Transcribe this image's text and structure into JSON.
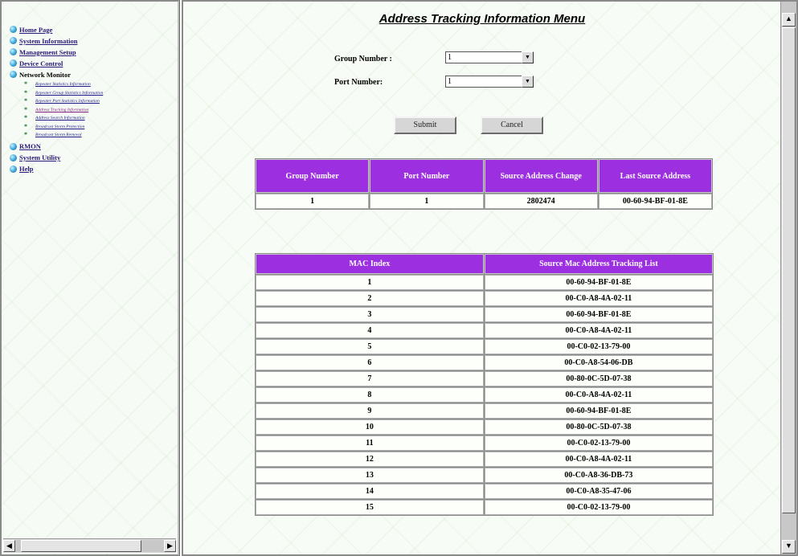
{
  "nav": {
    "items": [
      {
        "label": "Home Page"
      },
      {
        "label": "System Information"
      },
      {
        "label": "Management Setup"
      },
      {
        "label": "Device Control"
      },
      {
        "label": "Network Monitor"
      },
      {
        "label": "RMON"
      },
      {
        "label": "System Utility"
      },
      {
        "label": "Help"
      }
    ],
    "sub_items": [
      {
        "label": "Repeater Statistics Information"
      },
      {
        "label": "Repeater Group Statistics Information"
      },
      {
        "label": "Repeater Port Statistics Information"
      },
      {
        "label": "Address Tracking Information"
      },
      {
        "label": "Address Search Information"
      },
      {
        "label": "Broadcast Storm Protection"
      },
      {
        "label": "Broadcast Storm Removal"
      }
    ]
  },
  "page": {
    "title": "Address Tracking Information Menu"
  },
  "form": {
    "group_label": "Group Number :",
    "group_value": "1",
    "port_label": "Port Number:",
    "port_value": "1",
    "submit_label": "Submit",
    "cancel_label": "Cancel"
  },
  "summary": {
    "headers": [
      "Group Number",
      "Port Number",
      "Source Address Change",
      "Last Source Address"
    ],
    "row": [
      "1",
      "1",
      "2802474",
      "00-60-94-BF-01-8E"
    ]
  },
  "mac_table": {
    "headers": [
      "MAC Index",
      "Source Mac Address Tracking List"
    ],
    "rows": [
      [
        "1",
        "00-60-94-BF-01-8E"
      ],
      [
        "2",
        "00-C0-A8-4A-02-11"
      ],
      [
        "3",
        "00-60-94-BF-01-8E"
      ],
      [
        "4",
        "00-C0-A8-4A-02-11"
      ],
      [
        "5",
        "00-C0-02-13-79-00"
      ],
      [
        "6",
        "00-C0-A8-54-06-DB"
      ],
      [
        "7",
        "00-80-0C-5D-07-38"
      ],
      [
        "8",
        "00-C0-A8-4A-02-11"
      ],
      [
        "9",
        "00-60-94-BF-01-8E"
      ],
      [
        "10",
        "00-80-0C-5D-07-38"
      ],
      [
        "11",
        "00-C0-02-13-79-00"
      ],
      [
        "12",
        "00-C0-A8-4A-02-11"
      ],
      [
        "13",
        "00-C0-A8-36-DB-73"
      ],
      [
        "14",
        "00-C0-A8-35-47-06"
      ],
      [
        "15",
        "00-C0-02-13-79-00"
      ]
    ]
  },
  "colors": {
    "header_purple": "#9c2fe0",
    "link_blue": "#2a1a78"
  },
  "icons": {
    "nav_bullet": "globe-bullet-icon",
    "sub_bullet": "star-bullet-icon"
  }
}
